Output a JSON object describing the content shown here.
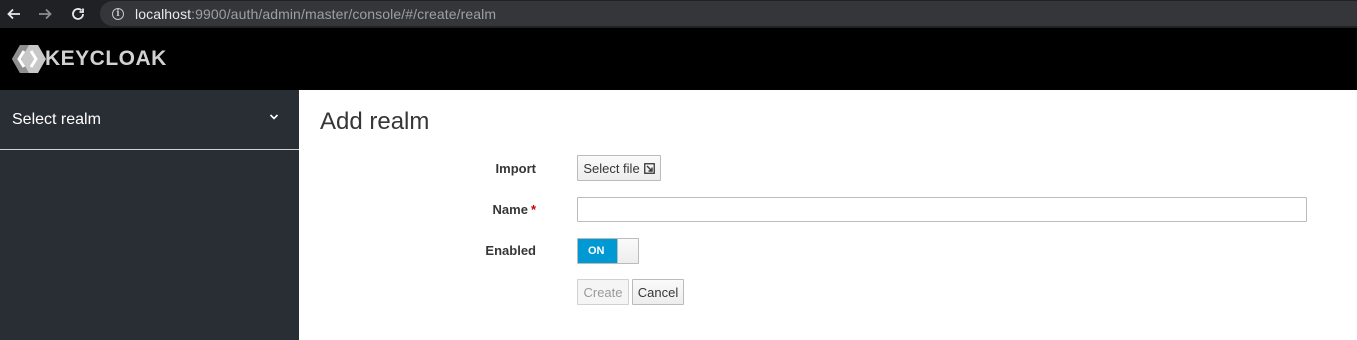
{
  "browser": {
    "back_icon": "arrow-left-icon",
    "forward_icon": "arrow-right-icon",
    "reload_icon": "reload-icon",
    "info_icon": "info-icon",
    "url_host": "localhost",
    "url_path": ":9900/auth/admin/master/console/#/create/realm"
  },
  "header": {
    "logo_text": "KEYCLOAK",
    "logo_icon": "keycloak-logo-icon"
  },
  "sidebar": {
    "realm_select_label": "Select realm",
    "chevron_icon": "chevron-down-icon"
  },
  "main": {
    "title": "Add realm",
    "form": {
      "import_label": "Import",
      "select_file_label": "Select file",
      "select_file_icon": "external-link-icon",
      "name_label": "Name",
      "name_required_marker": "*",
      "name_value": "",
      "enabled_label": "Enabled",
      "enabled_toggle_text": "ON",
      "enabled_value": true,
      "create_label": "Create",
      "create_disabled": true,
      "cancel_label": "Cancel"
    }
  },
  "colors": {
    "header_bg": "#000000",
    "sidebar_bg": "#292e34",
    "toggle_on": "#0099d3",
    "required": "#cc0000",
    "browser_chrome": "#202124"
  }
}
